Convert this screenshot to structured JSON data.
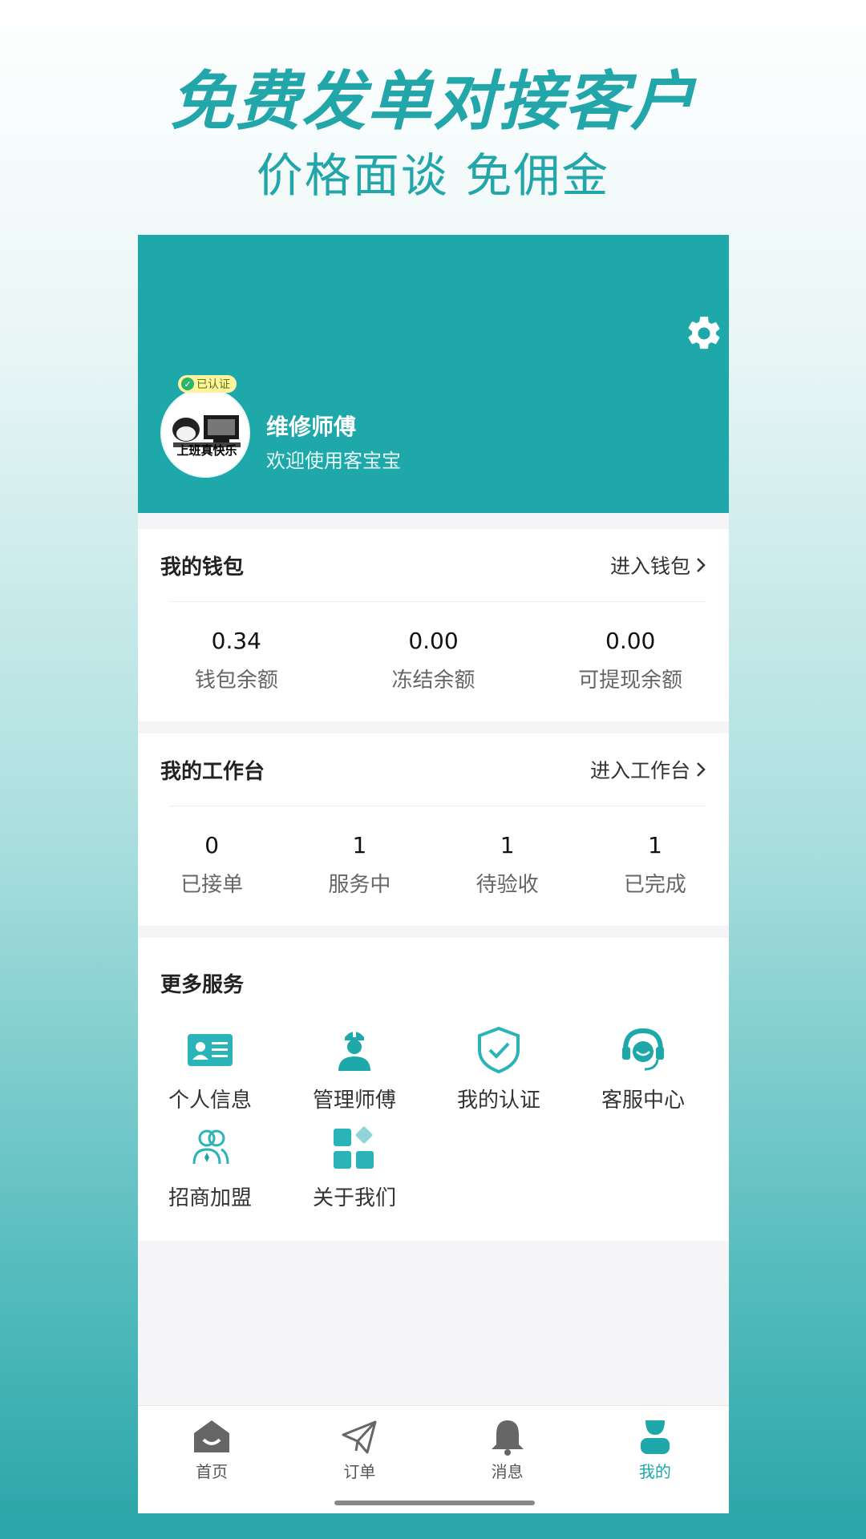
{
  "promo": {
    "title": "免费发单对接客户",
    "subtitle": "价格面谈 免佣金"
  },
  "profile": {
    "verified_badge": "已认证",
    "avatar_caption": "上班真快乐",
    "name": "维修师傅",
    "welcome": "欢迎使用客宝宝",
    "settings_icon": "gear-icon"
  },
  "wallet": {
    "title": "我的钱包",
    "link": "进入钱包",
    "stats": [
      {
        "value": "0.34",
        "label": "钱包余额"
      },
      {
        "value": "0.00",
        "label": "冻结余额"
      },
      {
        "value": "0.00",
        "label": "可提现余额"
      }
    ]
  },
  "workbench": {
    "title": "我的工作台",
    "link": "进入工作台",
    "stats": [
      {
        "value": "0",
        "label": "已接单"
      },
      {
        "value": "1",
        "label": "服务中"
      },
      {
        "value": "1",
        "label": "待验收"
      },
      {
        "value": "1",
        "label": "已完成"
      }
    ]
  },
  "services": {
    "title": "更多服务",
    "items": [
      {
        "label": "个人信息",
        "icon": "id-card-icon"
      },
      {
        "label": "管理师傅",
        "icon": "worker-icon"
      },
      {
        "label": "我的认证",
        "icon": "shield-check-icon"
      },
      {
        "label": "客服中心",
        "icon": "headset-icon"
      },
      {
        "label": "招商加盟",
        "icon": "people-icon"
      },
      {
        "label": "关于我们",
        "icon": "grid-icon"
      }
    ]
  },
  "tabbar": {
    "tabs": [
      {
        "label": "首页",
        "icon": "home-icon"
      },
      {
        "label": "订单",
        "icon": "paper-plane-icon"
      },
      {
        "label": "消息",
        "icon": "bell-icon"
      },
      {
        "label": "我的",
        "icon": "user-icon",
        "active": true
      }
    ]
  },
  "colors": {
    "accent": "#1ea8aa",
    "accent_light": "#2bb4b7"
  }
}
